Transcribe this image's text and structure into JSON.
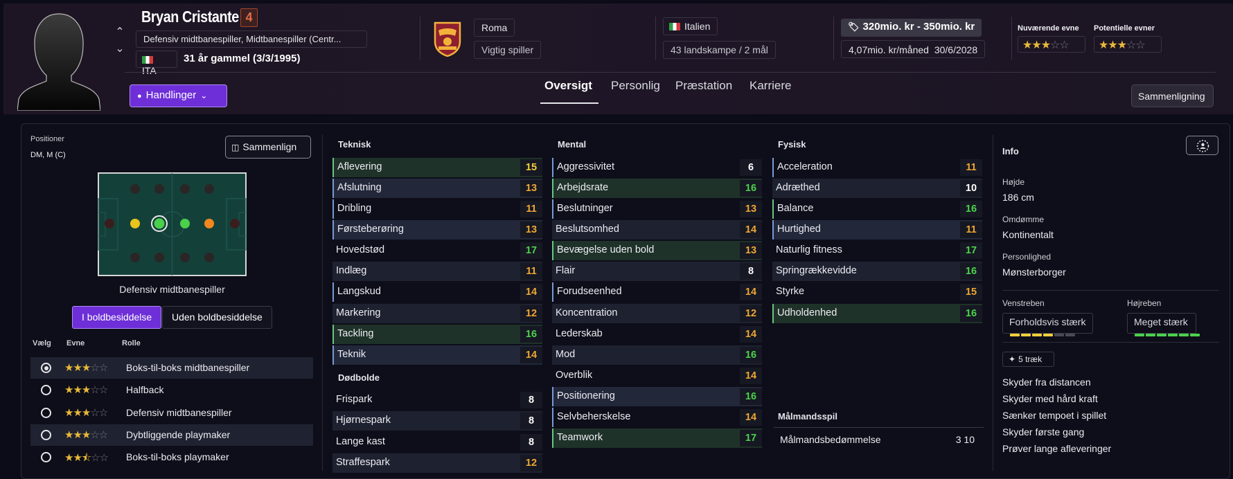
{
  "player": {
    "name": "Bryan Cristante",
    "number": "4",
    "positions": "Defensiv midtbanespiller, Midtbanespiller (Centr...",
    "nationality_code": "ITA",
    "age_text": "31 år gammel (3/3/1995)"
  },
  "club": {
    "name": "Roma",
    "status": "Vigtig spiller",
    "country": "Italien",
    "caps": "43 landskampe / 2 mål"
  },
  "contract": {
    "value": "320mio. kr - 350mio. kr",
    "wage": "4,07mio. kr/måned",
    "expiry": "30/6/2028"
  },
  "ability": {
    "current_label": "Nuværende evne",
    "potential_label": "Potentielle evner",
    "current_stars": 3,
    "potential_stars": 3
  },
  "actions_label": "Handlinger",
  "tabs": [
    "Oversigt",
    "Personlig",
    "Præstation",
    "Karriere"
  ],
  "compare_label": "Sammenligning",
  "positions_panel": {
    "title": "Positioner",
    "value": "DM, M (C)",
    "compare_label": "Sammenlign",
    "pitch_caption": "Defensiv midtbanespiller",
    "toggle_on": "I boldbesiddelse",
    "toggle_off": "Uden boldbesiddelse",
    "col_select": "Vælg",
    "col_ability": "Evne",
    "col_role": "Rolle",
    "roles": [
      {
        "name": "Boks-til-boks midtbanespiller",
        "stars": 3,
        "selected": true
      },
      {
        "name": "Halfback",
        "stars": 3,
        "selected": false
      },
      {
        "name": "Defensiv midtbanespiller",
        "stars": 3,
        "selected": false
      },
      {
        "name": "Dybtliggende playmaker",
        "stars": 3,
        "selected": false
      },
      {
        "name": "Boks-til-boks playmaker",
        "stars": 2.5,
        "selected": false
      }
    ]
  },
  "technical": {
    "title": "Teknisk",
    "items": [
      {
        "name": "Aflevering",
        "value": "15"
      },
      {
        "name": "Afslutning",
        "value": "13"
      },
      {
        "name": "Dribling",
        "value": "11"
      },
      {
        "name": "Førsteberøring",
        "value": "13"
      },
      {
        "name": "Hovedstød",
        "value": "17"
      },
      {
        "name": "Indlæg",
        "value": "11"
      },
      {
        "name": "Langskud",
        "value": "14"
      },
      {
        "name": "Markering",
        "value": "12"
      },
      {
        "name": "Tackling",
        "value": "16"
      },
      {
        "name": "Teknik",
        "value": "14"
      }
    ]
  },
  "setpieces": {
    "title": "Dødbolde",
    "items": [
      {
        "name": "Frispark",
        "value": "8"
      },
      {
        "name": "Hjørnespark",
        "value": "8"
      },
      {
        "name": "Lange kast",
        "value": "8"
      },
      {
        "name": "Straffespark",
        "value": "12"
      }
    ]
  },
  "mental": {
    "title": "Mental",
    "items": [
      {
        "name": "Aggressivitet",
        "value": "6"
      },
      {
        "name": "Arbejdsrate",
        "value": "16"
      },
      {
        "name": "Beslutninger",
        "value": "13"
      },
      {
        "name": "Beslutsomhed",
        "value": "14"
      },
      {
        "name": "Bevægelse uden bold",
        "value": "13"
      },
      {
        "name": "Flair",
        "value": "8"
      },
      {
        "name": "Forudseenhed",
        "value": "14"
      },
      {
        "name": "Koncentration",
        "value": "12"
      },
      {
        "name": "Lederskab",
        "value": "14"
      },
      {
        "name": "Mod",
        "value": "16"
      },
      {
        "name": "Overblik",
        "value": "14"
      },
      {
        "name": "Positionering",
        "value": "16"
      },
      {
        "name": "Selvbeherskelse",
        "value": "14"
      },
      {
        "name": "Teamwork",
        "value": "17"
      }
    ]
  },
  "physical": {
    "title": "Fysisk",
    "items": [
      {
        "name": "Acceleration",
        "value": "11"
      },
      {
        "name": "Adræthed",
        "value": "10"
      },
      {
        "name": "Balance",
        "value": "16"
      },
      {
        "name": "Hurtighed",
        "value": "11"
      },
      {
        "name": "Naturlig fitness",
        "value": "17"
      },
      {
        "name": "Springrækkevidde",
        "value": "16"
      },
      {
        "name": "Styrke",
        "value": "15"
      },
      {
        "name": "Udholdenhed",
        "value": "16"
      }
    ]
  },
  "goalkeeping": {
    "title": "Målmandsspil",
    "label": "Målmandsbedømmelse",
    "value": "3 10"
  },
  "info": {
    "title": "Info",
    "height_label": "Højde",
    "height": "186 cm",
    "reputation_label": "Omdømme",
    "reputation": "Kontinentalt",
    "personality_label": "Personlighed",
    "personality": "Mønsterborger",
    "left_foot_label": "Venstreben",
    "left_foot": "Forholdsvis stærk",
    "left_foot_level": 4,
    "right_foot_label": "Højreben",
    "right_foot": "Meget stærk",
    "right_foot_level": 6,
    "foot_max": 6,
    "traits_label": "5 træk",
    "traits": [
      "Skyder fra distancen",
      "Skyder med hård kraft",
      "Sænker tempoet i spillet",
      "Skyder første gang",
      "Prøver lange afleveringer"
    ]
  },
  "colors": {
    "accent": "#6e2fd8",
    "orange": "#f0a733",
    "green": "#4dd24d",
    "yellow": "#f3cf3b",
    "star": "#e9b93b"
  }
}
